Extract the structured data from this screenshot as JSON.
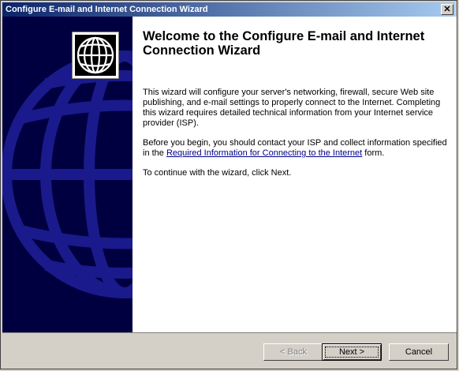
{
  "window": {
    "title": "Configure E-mail and Internet Connection Wizard",
    "close_glyph": "✕"
  },
  "main": {
    "heading": "Welcome to the Configure E-mail and Internet Connection Wizard",
    "paragraph1": "This wizard will configure your server's networking, firewall, secure Web site publishing, and e-mail settings to properly connect to the Internet. Completing this wizard requires detailed technical information from your Internet service provider (ISP).",
    "paragraph2_prefix": "Before you begin, you should contact your ISP and collect information specified in the ",
    "paragraph2_link": "Required Information for Connecting to the Internet",
    "paragraph2_suffix": " form.",
    "paragraph3": "To continue with the wizard, click Next."
  },
  "buttons": {
    "back": "< Back",
    "next": "Next >",
    "cancel": "Cancel"
  },
  "colors": {
    "sidebar": "#000040",
    "globe": "#1a1a8c",
    "titlebar_start": "#0a246a",
    "titlebar_end": "#a6caf0",
    "link": "#00008b"
  },
  "icons": {
    "logo": "globe-icon",
    "sidebar_art": "globe-watermark"
  }
}
